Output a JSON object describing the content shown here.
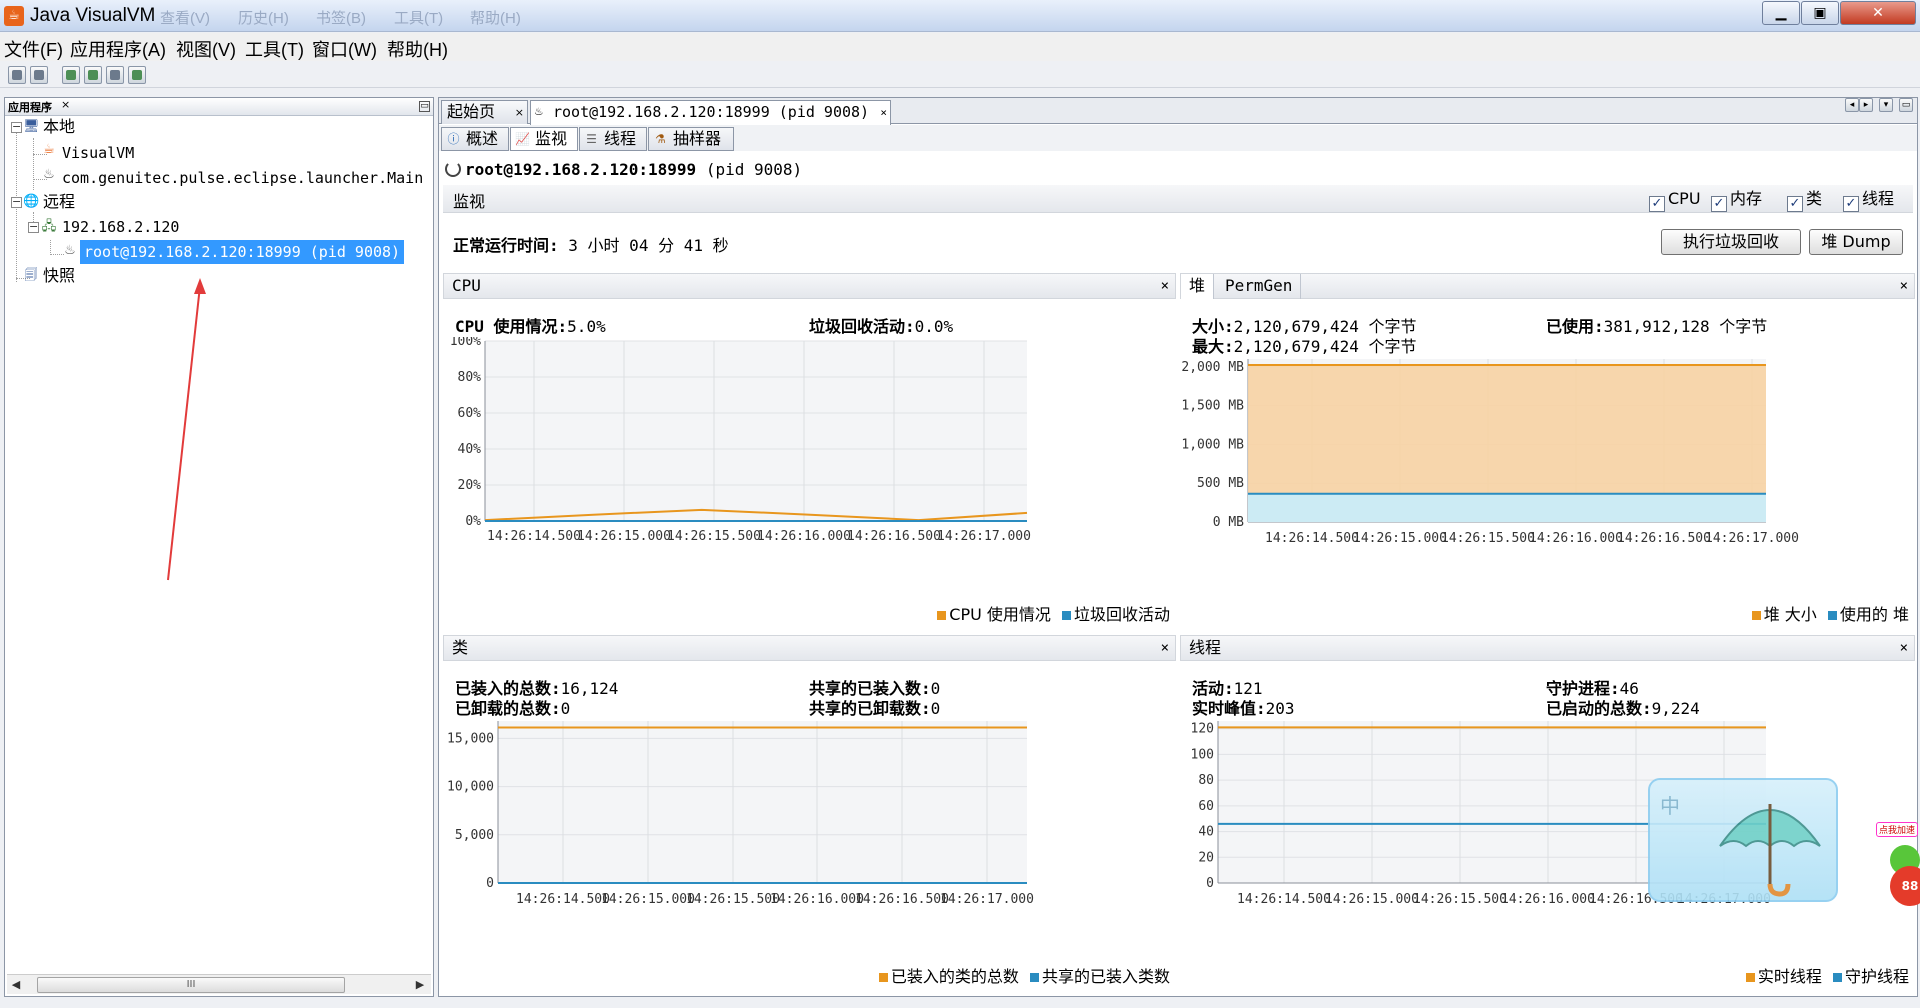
{
  "window": {
    "title": "Java VisualVM",
    "ghost_tabs": [
      "查看(V)",
      "历史(H)",
      "书签(B)",
      "工具(T)",
      "帮助(H)"
    ],
    "min_symbol": "▁",
    "max_symbol": "▣",
    "close_symbol": "✕"
  },
  "menu": [
    "文件(F)",
    "应用程序(A)",
    "视图(V)",
    "工具(T)",
    "窗口(W)",
    "帮助(H)"
  ],
  "left_panel": {
    "title": "应用程序",
    "close": "×",
    "min": "▭",
    "tree": {
      "local": "本地",
      "visualvm": "VisualVM",
      "launcher": "com.genuitec.pulse.eclipse.launcher.Main",
      "remote": "远程",
      "host": "192.168.2.120",
      "jmx": "root@192.168.2.120:18999 (pid 9008)",
      "snapshots": "快照"
    },
    "scroll": {
      "left": "◀",
      "right": "▶",
      "grip": "III"
    }
  },
  "doc_tabs": {
    "start": "起始页",
    "app": "root@192.168.2.120:18999 (pid 9008)",
    "close": "×",
    "nav": [
      "◂",
      "▸",
      "▾",
      "▭"
    ]
  },
  "sub_tabs": [
    "概述",
    "监视",
    "线程",
    "抽样器"
  ],
  "header": {
    "app_bold": "root@192.168.2.120:18999",
    "app_pid": "(pid 9008)"
  },
  "monitor": {
    "label": "监视",
    "checks": [
      {
        "label": "CPU",
        "checked": true
      },
      {
        "label": "内存",
        "checked": true
      },
      {
        "label": "类",
        "checked": true
      },
      {
        "label": "线程",
        "checked": true
      }
    ],
    "check_mark": "✓",
    "uptime_label": "正常运行时间:",
    "uptime_value": "3 小时 04 分 41 秒",
    "gc_button": "执行垃圾回收",
    "dump_button": "堆 Dump"
  },
  "times": [
    "14:26:14.500",
    "14:26:15.000",
    "14:26:15.500",
    "14:26:16.000",
    "14:26:16.500",
    "14:26:17.000"
  ],
  "cpu": {
    "title": "CPU",
    "close": "×",
    "usage_label": "CPU 使用情况:",
    "usage_value": "5.0%",
    "gc_label": "垃圾回收活动:",
    "gc_value": "0.0%",
    "yticks": [
      "100%",
      "80%",
      "60%",
      "40%",
      "20%",
      "0%"
    ],
    "legend": [
      "CPU 使用情况",
      "垃圾回收活动"
    ],
    "colors": [
      "#e8961e",
      "#2a8cc0"
    ]
  },
  "heap": {
    "tab_heap": "堆",
    "tab_permgen": "PermGen",
    "close": "×",
    "size_label": "大小:",
    "size_value": "2,120,679,424 个字节",
    "max_label": "最大:",
    "max_value": "2,120,679,424 个字节",
    "used_label": "已使用:",
    "used_value": "381,912,128 个字节",
    "yticks": [
      "2,000 MB",
      "1,500 MB",
      "1,000 MB",
      "500 MB",
      "0 MB"
    ],
    "legend": [
      "堆 大小",
      "使用的 堆"
    ]
  },
  "classes": {
    "title": "类",
    "close": "×",
    "loaded_label": "已装入的总数:",
    "loaded_value": "16,124",
    "unloaded_label": "已卸载的总数:",
    "unloaded_value": "0",
    "shared_loaded_label": "共享的已装入数:",
    "shared_loaded_value": "0",
    "shared_unloaded_label": "共享的已卸载数:",
    "shared_unloaded_value": "0",
    "yticks": [
      "15,000",
      "10,000",
      "5,000",
      "0"
    ],
    "legend": [
      "已装入的类的总数",
      "共享的已装入类数"
    ]
  },
  "threads": {
    "title": "线程",
    "close": "×",
    "live_label": "活动:",
    "live_value": "121",
    "peak_label": "实时峰值:",
    "peak_value": "203",
    "daemon_label": "守护进程:",
    "daemon_value": "46",
    "started_label": "已启动的总数:",
    "started_value": "9,224",
    "yticks": [
      "120",
      "100",
      "80",
      "60",
      "40",
      "20",
      "0"
    ],
    "legend": [
      "实时线程",
      "守护线程"
    ]
  },
  "overlay": {
    "sticker_char": "中",
    "badge_label": "点我加速",
    "badge_value": "88"
  },
  "chart_data": [
    {
      "type": "line",
      "x": [
        "14:26:14.500",
        "14:26:15.000",
        "14:26:15.500",
        "14:26:16.000",
        "14:26:16.500",
        "14:26:17.000"
      ],
      "series": [
        {
          "name": "CPU 使用情况",
          "values": [
            0.5,
            3.5,
            6.2,
            3.5,
            0.5,
            4.5
          ]
        },
        {
          "name": "垃圾回收活动",
          "values": [
            0,
            0,
            0,
            0,
            0,
            0
          ]
        }
      ],
      "title": "CPU",
      "ylim": [
        0,
        100
      ]
    },
    {
      "type": "area",
      "x": [
        "14:26:14.500",
        "14:26:15.000",
        "14:26:15.500",
        "14:26:16.000",
        "14:26:16.500",
        "14:26:17.000"
      ],
      "series": [
        {
          "name": "堆 大小",
          "values": [
            2022,
            2022,
            2022,
            2022,
            2022,
            2022
          ]
        },
        {
          "name": "使用的 堆",
          "values": [
            364,
            364,
            364,
            364,
            364,
            364
          ]
        }
      ],
      "ylim": [
        0,
        2100
      ]
    },
    {
      "type": "line",
      "x": [
        "14:26:14.500",
        "14:26:15.000",
        "14:26:15.500",
        "14:26:16.000",
        "14:26:16.500",
        "14:26:17.000"
      ],
      "series": [
        {
          "name": "已装入的类的总数",
          "values": [
            16124,
            16124,
            16124,
            16124,
            16124,
            16124
          ]
        },
        {
          "name": "共享的已装入类数",
          "values": [
            0,
            0,
            0,
            0,
            0,
            0
          ]
        }
      ],
      "title": "类",
      "ylim": [
        0,
        16800
      ]
    },
    {
      "type": "line",
      "x": [
        "14:26:14.500",
        "14:26:15.000",
        "14:26:15.500",
        "14:26:16.000",
        "14:26:16.500",
        "14:26:17.000"
      ],
      "series": [
        {
          "name": "实时线程",
          "values": [
            121,
            121,
            121,
            121,
            121,
            121
          ]
        },
        {
          "name": "守护线程",
          "values": [
            46,
            46,
            46,
            46,
            46,
            46
          ]
        }
      ],
      "title": "线程",
      "ylim": [
        0,
        126
      ]
    }
  ]
}
